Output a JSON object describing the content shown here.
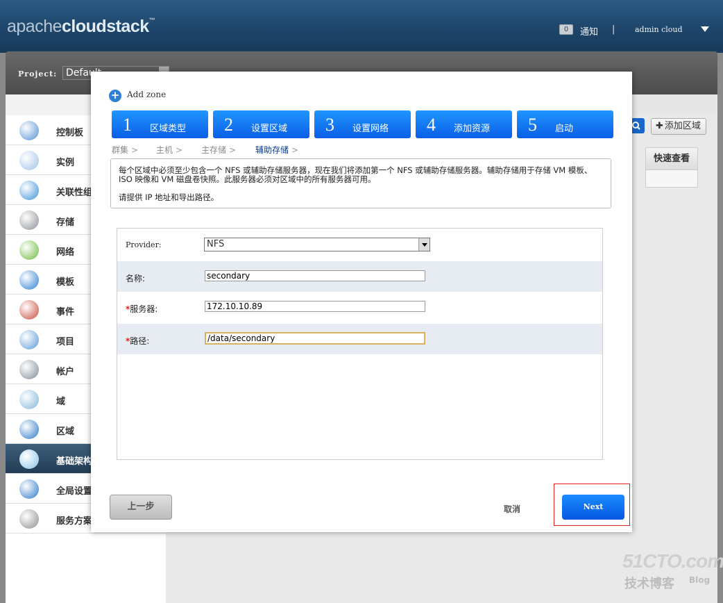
{
  "header": {
    "logo_light": "apache",
    "logo_bold": "cloudstack",
    "logo_tm": "™",
    "notification_count": "0",
    "notification_label": "通知",
    "separator": "|",
    "user": "admin cloud"
  },
  "project": {
    "label": "Project:",
    "value": "Default"
  },
  "sidebar": {
    "items": [
      {
        "label": "控制板",
        "icon": "dashboard-icon",
        "color": "#4f8fd3"
      },
      {
        "label": "实例",
        "icon": "cloud-icon",
        "color": "#9fc3e6"
      },
      {
        "label": "关联性组",
        "icon": "affinity-icon",
        "color": "#3d91d8"
      },
      {
        "label": "存储",
        "icon": "storage-icon",
        "color": "#8a8f96"
      },
      {
        "label": "网络",
        "icon": "network-icon",
        "color": "#6cbb3a"
      },
      {
        "label": "模板",
        "icon": "template-icon",
        "color": "#2d7fd0"
      },
      {
        "label": "事件",
        "icon": "calendar-icon",
        "color": "#c94a3a"
      },
      {
        "label": "项目",
        "icon": "folder-icon",
        "color": "#5a9ad8"
      },
      {
        "label": "帐户",
        "icon": "user-icon",
        "color": "#7d8a99"
      },
      {
        "label": "域",
        "icon": "domain-icon",
        "color": "#7fb5d8"
      },
      {
        "label": "区域",
        "icon": "globe-icon",
        "color": "#2b78c7"
      },
      {
        "label": "基础架构",
        "icon": "infrastructure-icon",
        "color": "#89c2ea"
      },
      {
        "label": "全局设置",
        "icon": "global-settings-icon",
        "color": "#2b78c7"
      },
      {
        "label": "服务方案",
        "icon": "gear-icon",
        "color": "#8d8d8d"
      }
    ]
  },
  "toolbar": {
    "add_zone": "添加区域",
    "quick_view": "快速查看"
  },
  "dialog": {
    "title": "Add zone",
    "steps": [
      {
        "num": "1",
        "label": "区域类型"
      },
      {
        "num": "2",
        "label": "设置区域"
      },
      {
        "num": "3",
        "label": "设置网络"
      },
      {
        "num": "4",
        "label": "添加资源"
      },
      {
        "num": "5",
        "label": "启动"
      }
    ],
    "breadcrumbs": [
      "群集",
      "主机",
      "主存储",
      "辅助存储"
    ],
    "info_line1": "每个区域中必须至少包含一个 NFS 或辅助存储服务器，现在我们将添加第一个 NFS 或辅助存储服务器。辅助存储用于存储 VM 模板、ISO 映像和 VM 磁盘卷快照。此服务器必须对区域中的所有服务器可用。",
    "info_line2": "请提供 IP 地址和导出路径。",
    "form": {
      "provider_label": "Provider:",
      "provider_value": "NFS",
      "name_label": "名称:",
      "name_value": "secondary",
      "server_label": "服务器:",
      "server_value": "172.10.10.89",
      "path_label": "路径:",
      "path_value": "/data/secondary"
    },
    "prev_button": "上一步",
    "cancel_button": "取消",
    "next_button": "Next"
  },
  "watermark": {
    "site": "51CTO.com",
    "tagline": "技术博客",
    "blog": "Blog"
  }
}
